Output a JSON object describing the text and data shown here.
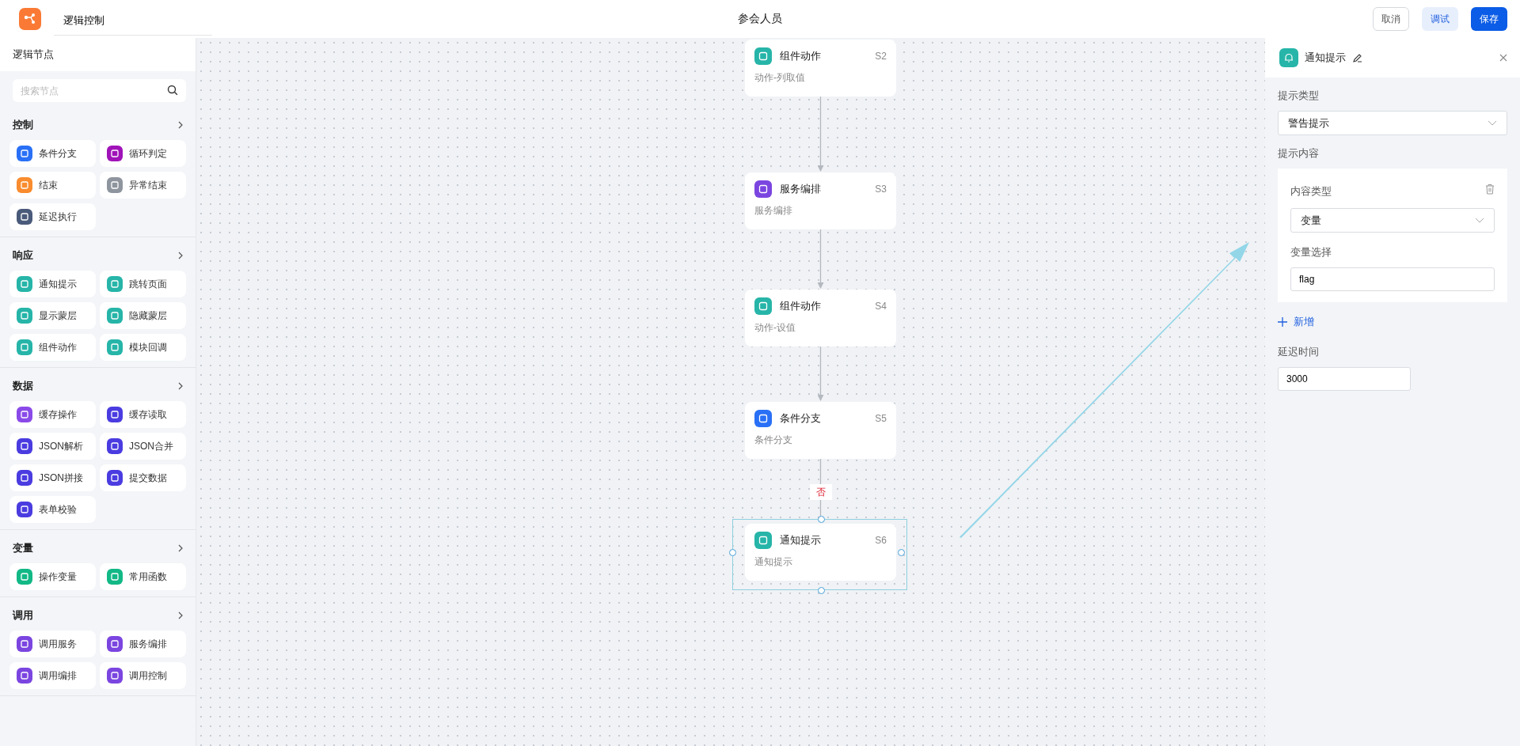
{
  "app": {
    "name": "逻辑控制",
    "page_title": "参会人员",
    "buttons": [
      {
        "label": "取消",
        "kind": "default"
      },
      {
        "label": "调试",
        "kind": "light"
      },
      {
        "label": "保存",
        "kind": "primary"
      }
    ]
  },
  "sidebar": {
    "title": "逻辑节点",
    "search": {
      "placeholder": "搜索节点"
    },
    "groups": [
      {
        "title": "控制",
        "items": [
          {
            "label": "条件分支",
            "color": "#2970f6"
          },
          {
            "label": "循环判定",
            "color": "#a013b8"
          },
          {
            "label": "结束",
            "color": "#f98c2e"
          },
          {
            "label": "异常结束",
            "color": "#8f959e"
          },
          {
            "label": "延迟执行",
            "color": "#4a5a7a"
          }
        ]
      },
      {
        "title": "响应",
        "items": [
          {
            "label": "通知提示",
            "color": "#26b5a8"
          },
          {
            "label": "跳转页面",
            "color": "#26b5a8"
          },
          {
            "label": "显示蒙层",
            "color": "#26b5a8"
          },
          {
            "label": "隐藏蒙层",
            "color": "#26b5a8"
          },
          {
            "label": "组件动作",
            "color": "#26b5a8"
          },
          {
            "label": "模块回调",
            "color": "#26b5a8"
          }
        ]
      },
      {
        "title": "数据",
        "items": [
          {
            "label": "缓存操作",
            "color": "#8a4ae8"
          },
          {
            "label": "缓存读取",
            "color": "#4a3ce0"
          },
          {
            "label": "JSON解析",
            "color": "#4a3ce0"
          },
          {
            "label": "JSON合并",
            "color": "#4a3ce0"
          },
          {
            "label": "JSON拼接",
            "color": "#4a3ce0"
          },
          {
            "label": "提交数据",
            "color": "#4a3ce0"
          },
          {
            "label": "表单校验",
            "color": "#4a3ce0"
          }
        ]
      },
      {
        "title": "变量",
        "items": [
          {
            "label": "操作变量",
            "color": "#12b886"
          },
          {
            "label": "常用函数",
            "color": "#12b886"
          }
        ]
      },
      {
        "title": "调用",
        "items": [
          {
            "label": "调用服务",
            "color": "#7b45e0"
          },
          {
            "label": "服务编排",
            "color": "#7b45e0"
          },
          {
            "label": "调用编排",
            "color": "#7b45e0"
          },
          {
            "label": "调用控制",
            "color": "#7b45e0"
          }
        ]
      }
    ]
  },
  "canvas": {
    "nodes": [
      {
        "title": "组件动作",
        "code": "S2",
        "subtitle": "动作-列取值",
        "color": "#26b5a8",
        "selected": false
      },
      {
        "title": "服务编排",
        "code": "S3",
        "subtitle": "服务编排",
        "color": "#7b45e0",
        "selected": false
      },
      {
        "title": "组件动作",
        "code": "S4",
        "subtitle": "动作-设值",
        "color": "#26b5a8",
        "selected": false
      },
      {
        "title": "条件分支",
        "code": "S5",
        "subtitle": "条件分支",
        "color": "#2970f6",
        "selected": false
      },
      {
        "title": "通知提示",
        "code": "S6",
        "subtitle": "通知提示",
        "color": "#26b5a8",
        "selected": true,
        "edge_label": "否"
      }
    ]
  },
  "panel": {
    "title": "通知提示",
    "color": "#26b5a8",
    "notice_type": {
      "label": "提示类型",
      "value": "警告提示"
    },
    "content": {
      "label": "提示内容",
      "items": [
        {
          "type_label": "内容类型",
          "type_value": "变量",
          "var_label": "变量选择",
          "var_value": "flag"
        }
      ],
      "add": "新增"
    },
    "delay": {
      "label": "延迟时间",
      "value": "3000"
    }
  }
}
